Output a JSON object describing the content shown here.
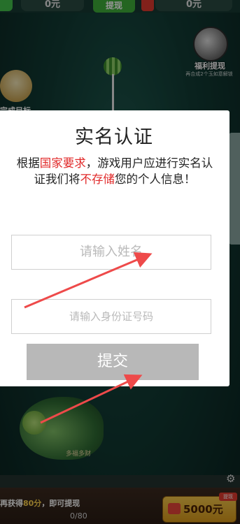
{
  "topbar": {
    "left_amount": "0元",
    "withdraw_label": "提现",
    "right_amount": "0元",
    "icons": {
      "left": "wechat-icon",
      "right": "red-envelope-icon"
    }
  },
  "welfare": {
    "title": "福利提现",
    "subtitle": "再合成2个玉如意解锁"
  },
  "game": {
    "goal_label": "完成目标",
    "dragon_tag": "多福多财"
  },
  "bottom": {
    "hint_prefix": "再获得",
    "hint_points": "80分",
    "hint_suffix": "，即可提现",
    "progress": "0/80",
    "cash_amount": "5000元",
    "cash_badge": "提现"
  },
  "dialog": {
    "title": "实名认证",
    "desc_part1": "根据",
    "desc_em1": "国家要求",
    "desc_part2": "，游戏用户应进行实名认证我们将",
    "desc_em2": "不存储",
    "desc_part3": "您的个人信息！",
    "name_placeholder": "请输入姓名",
    "id_placeholder": "请输入身份证号码",
    "submit_label": "提交"
  },
  "colors": {
    "accent_red": "#e12a2a",
    "arrow": "#ee4a4a",
    "submit_gray": "#b8b8b8"
  }
}
